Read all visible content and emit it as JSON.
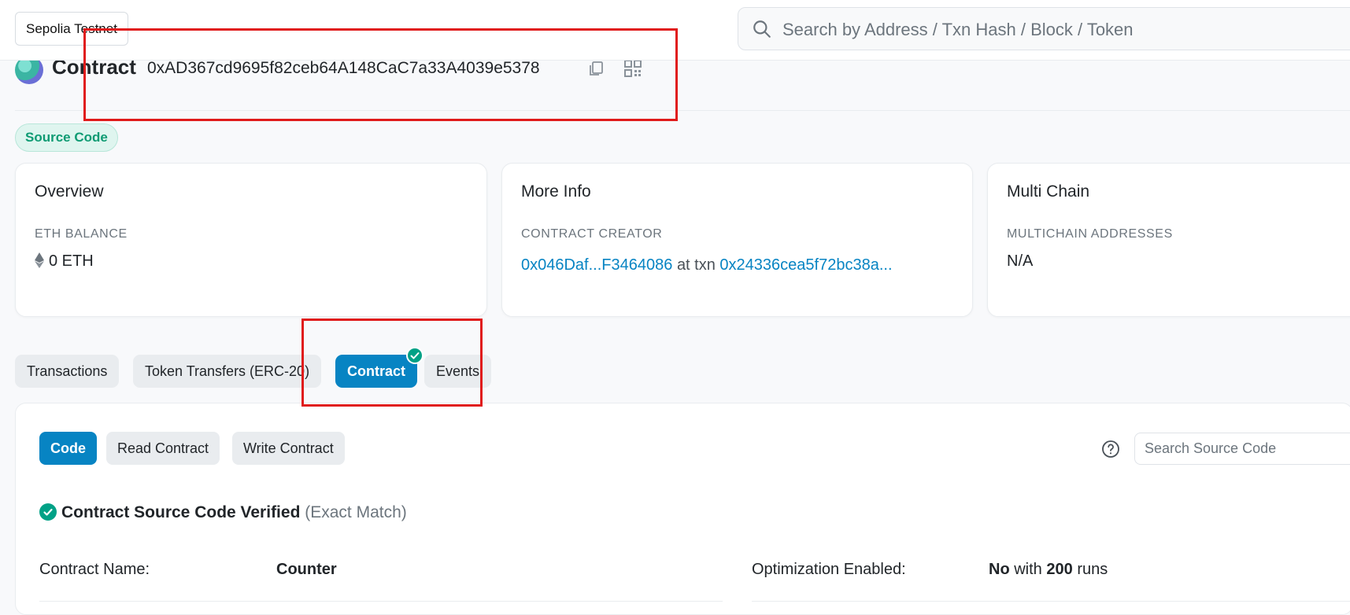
{
  "topbar": {
    "network": "Sepolia Testnet",
    "search_placeholder": "Search by Address / Txn Hash / Block / Token"
  },
  "header": {
    "title": "Contract",
    "address": "0xAD367cd9695f82ceb64A148CaC7a33A4039e5378"
  },
  "badge": {
    "source_code": "Source Code"
  },
  "cards": {
    "overview": {
      "title": "Overview",
      "label": "ETH BALANCE",
      "value": "0 ETH"
    },
    "more_info": {
      "title": "More Info",
      "label": "CONTRACT CREATOR",
      "creator": "0x046Daf...F3464086",
      "at_txn": "at txn",
      "txn": "0x24336cea5f72bc38a..."
    },
    "multi_chain": {
      "title": "Multi Chain",
      "label": "MULTICHAIN ADDRESSES",
      "value": "N/A"
    }
  },
  "tabs": [
    {
      "label": "Transactions"
    },
    {
      "label": "Token Transfers (ERC-20)"
    },
    {
      "label": "Contract"
    },
    {
      "label": "Events"
    }
  ],
  "subtabs": [
    {
      "label": "Code"
    },
    {
      "label": "Read Contract"
    },
    {
      "label": "Write Contract"
    }
  ],
  "source_search_placeholder": "Search Source Code",
  "verification": {
    "title": "Contract Source Code Verified",
    "match": "(Exact Match)"
  },
  "details": {
    "name_label": "Contract Name:",
    "name_value": "Counter",
    "opt_label": "Optimization Enabled:",
    "opt_value_no": "No",
    "opt_with": "with",
    "opt_runs": "200",
    "opt_runs_word": "runs"
  },
  "colors": {
    "accent": "#0784c3",
    "verified_green": "#00a186",
    "annotation_red": "#e01b1b"
  }
}
